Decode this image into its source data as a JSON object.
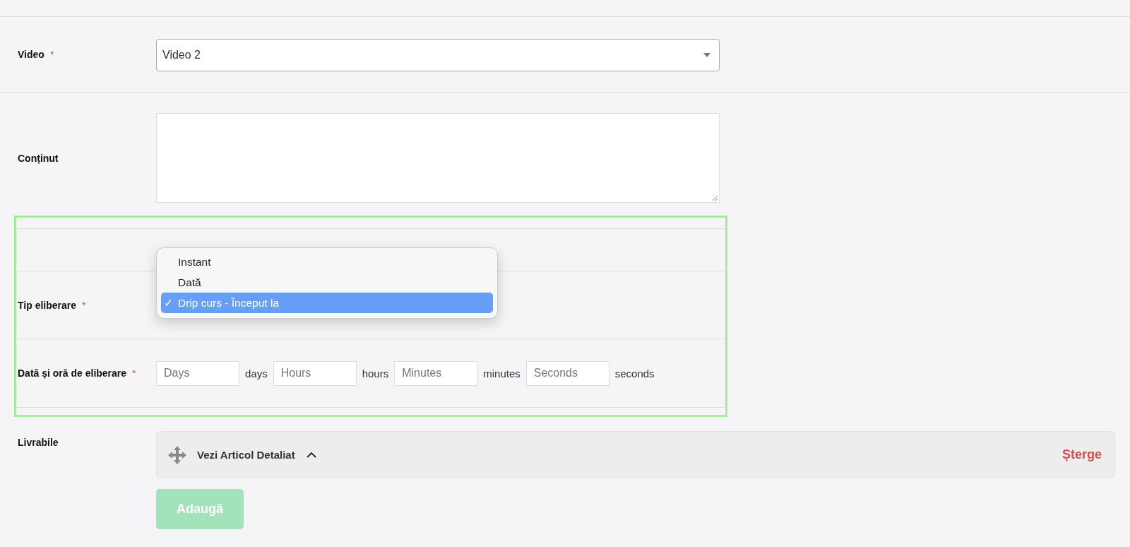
{
  "video": {
    "label": "Video",
    "required_mark": "*",
    "value": "Video 2"
  },
  "content": {
    "label": "Conținut"
  },
  "release_type": {
    "label": "Tip eliberare",
    "required_mark": "*",
    "check_mark": "✓",
    "options": [
      {
        "label": "Instant",
        "selected": false
      },
      {
        "label": "Dată",
        "selected": false
      },
      {
        "label": "Drip curs - Început la",
        "selected": true
      }
    ]
  },
  "release_time": {
    "label": "Dată și oră de eliberare",
    "required_mark": "*",
    "fields": [
      {
        "placeholder": "Days",
        "unit": "days"
      },
      {
        "placeholder": "Hours",
        "unit": "hours"
      },
      {
        "placeholder": "Minutes",
        "unit": "minutes"
      },
      {
        "placeholder": "Seconds",
        "unit": "seconds"
      }
    ]
  },
  "deliverables": {
    "label": "Livrabile",
    "items": [
      {
        "title": "Vezi Articol Detaliat",
        "expanded": true,
        "delete": "Șterge"
      }
    ],
    "add_button": "Adaugă"
  }
}
